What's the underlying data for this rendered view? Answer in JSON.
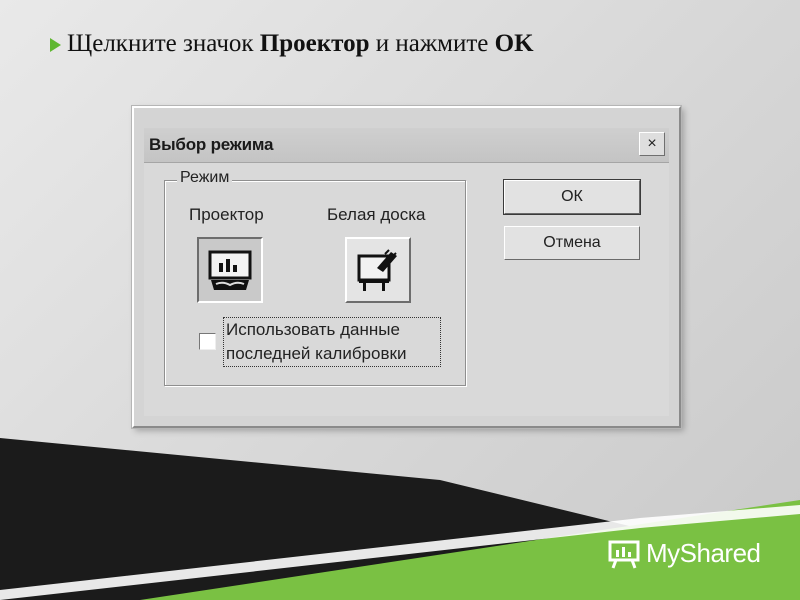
{
  "instruction": {
    "prefix": "Щелкните значок",
    "target": "Проектор",
    "middle": "и нажмите",
    "action": "OK"
  },
  "dialog": {
    "title": "Выбор режима",
    "close_label": "×",
    "group_label": "Режим",
    "projector_label": "Проектор",
    "whiteboard_label": "Белая доска",
    "checkbox_line1": "Использовать данные",
    "checkbox_line2": "последней калибровки",
    "ok_label": "ОК",
    "cancel_label": "Отмена"
  },
  "branding": {
    "logo_text": "MyShared"
  },
  "colors": {
    "accent_green": "#7ac143",
    "dark_band": "#1b1b1b",
    "bullet": "#5fb731"
  },
  "icons": [
    "bullet-arrow-icon",
    "close-icon",
    "projector-icon",
    "whiteboard-icon",
    "myshared-logo-icon"
  ]
}
